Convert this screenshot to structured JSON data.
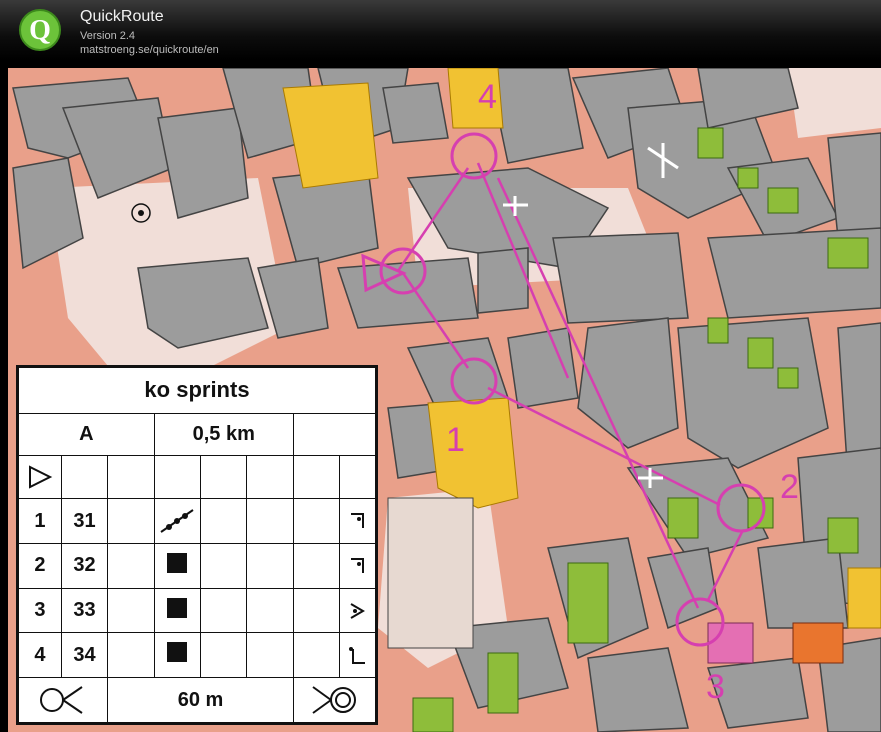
{
  "app": {
    "title": "QuickRoute",
    "version": "Version 2.4",
    "url": "matstroeng.se/quickroute/en",
    "logo_letter": "Q"
  },
  "map": {
    "control_numbers": [
      "1",
      "2",
      "3",
      "4"
    ],
    "colors": {
      "course": "#d63fb0",
      "road": "#e9a08a",
      "building": "#9c9c9c",
      "paved": "#f1ded8",
      "green": "#8ebd3a",
      "yellow": "#f1c232"
    }
  },
  "legend": {
    "event_title": "ko sprints",
    "course_name": "A",
    "length": "0,5 km",
    "controls": [
      {
        "num": "1",
        "code": "31",
        "feature": "line-feature-icon",
        "detail": "corner-icon"
      },
      {
        "num": "2",
        "code": "32",
        "feature": "square-feature-icon",
        "detail": "corner-icon"
      },
      {
        "num": "3",
        "code": "33",
        "feature": "square-feature-icon",
        "detail": "angle-icon"
      },
      {
        "num": "4",
        "code": "34",
        "feature": "square-feature-icon",
        "detail": "corner-dot-icon"
      }
    ],
    "finish_distance": "60 m"
  }
}
